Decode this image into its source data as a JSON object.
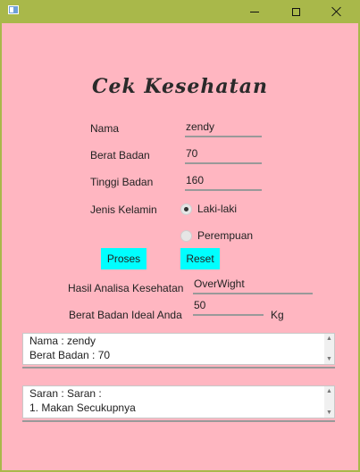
{
  "window": {
    "title_buttons": {
      "minimize_icon": "minimize-icon",
      "maximize_icon": "maximize-icon",
      "close_icon": "close-icon"
    },
    "accent_color": "#a9b84a",
    "background_color": "#ffb6c1"
  },
  "form": {
    "title": "Cek Kesehatan",
    "nama_label": "Nama",
    "nama_value": "zendy",
    "berat_label": "Berat Badan",
    "berat_value": "70",
    "tinggi_label": "Tinggi Badan",
    "tinggi_value": "160",
    "gender_label": "Jenis Kelamin",
    "gender_options": [
      {
        "label": "Laki-laki",
        "selected": true
      },
      {
        "label": "Perempuan",
        "selected": false
      }
    ],
    "proses_label": "Proses",
    "reset_label": "Reset",
    "button_color": "#00ffff",
    "hasil_label": "Hasil Analisa Kesehatan",
    "hasil_value": "OverWight",
    "ideal_label": "Berat Badan Ideal Anda",
    "ideal_value": "50",
    "ideal_unit": "Kg"
  },
  "output": {
    "summary_lines": [
      "Nama : zendy",
      "Berat Badan : 70"
    ],
    "saran_lines": [
      "Saran : Saran :",
      "1. Makan Secukupnya"
    ]
  }
}
